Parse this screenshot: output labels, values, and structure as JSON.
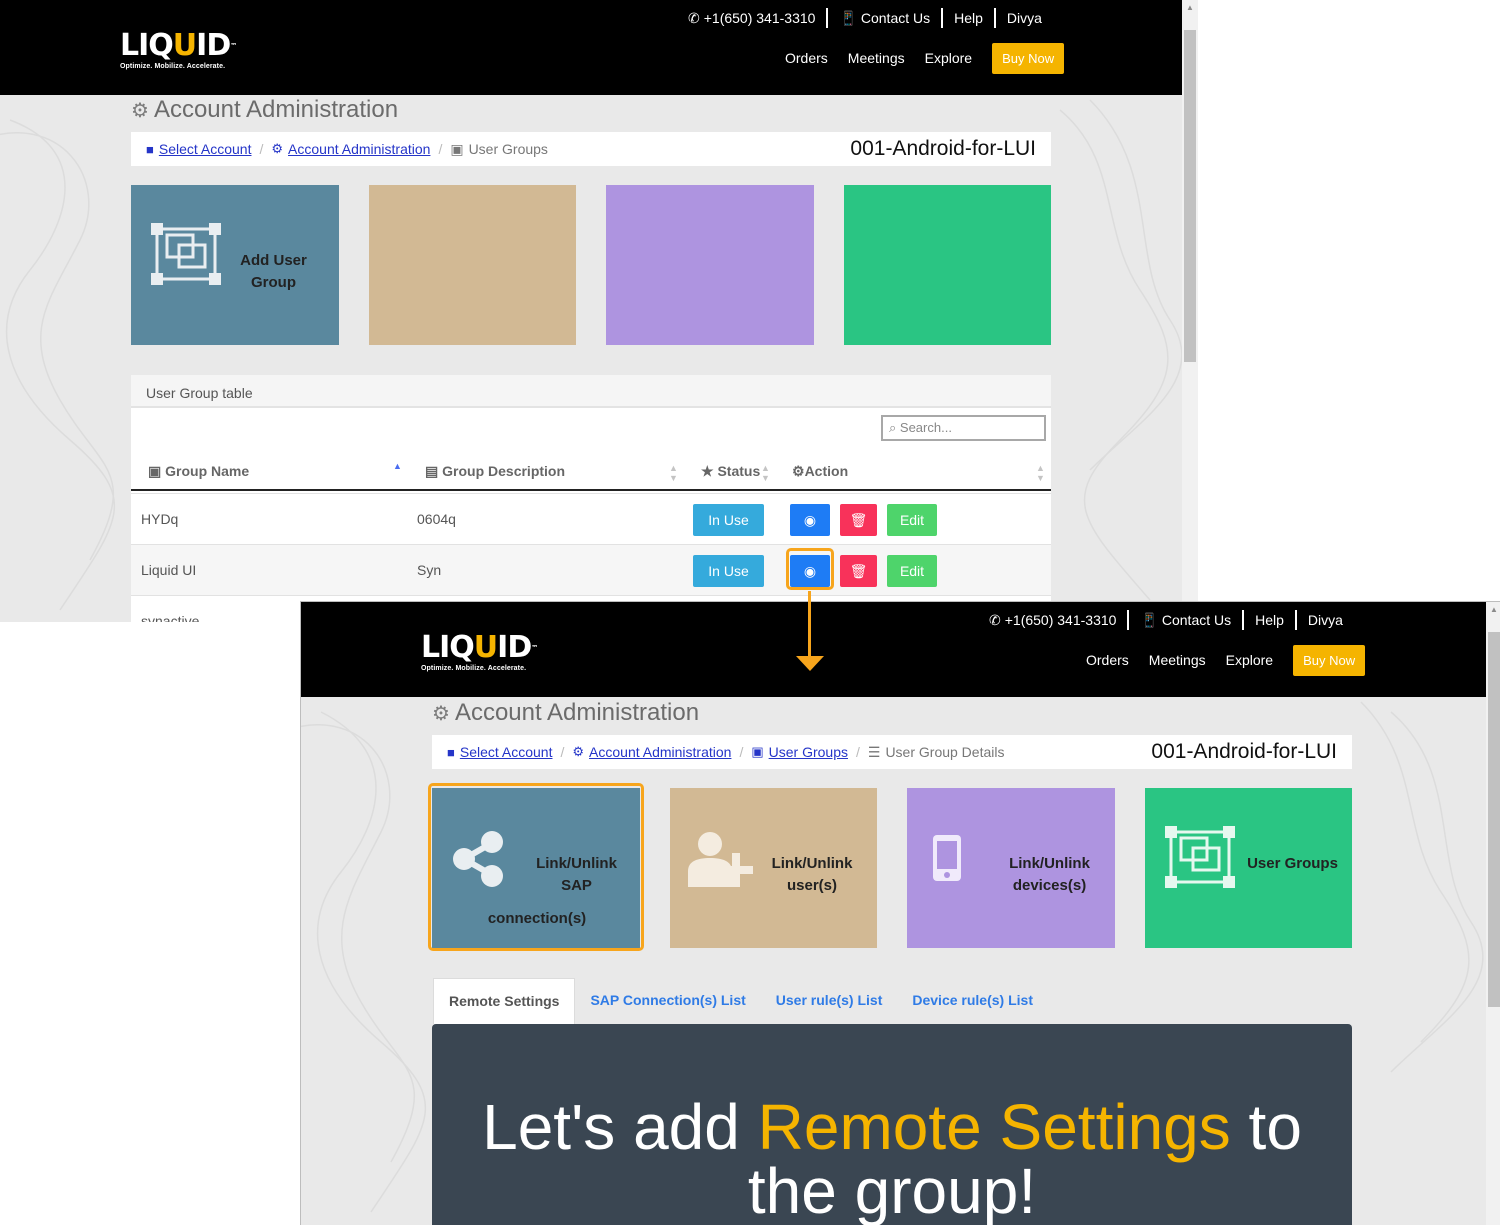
{
  "header": {
    "logo_main": "LIQ",
    "logo_accent": "U",
    "logo_end": "ID",
    "logo_tm": "™",
    "logo_tagline": "Optimize. Mobilize. Accelerate.",
    "phone": "+1(650) 341-3310",
    "contact": "Contact Us",
    "help": "Help",
    "user": "Divya",
    "nav": [
      "Orders",
      "Meetings",
      "Explore"
    ],
    "buy_now": "Buy Now"
  },
  "page_title": "Account Administration",
  "account_name": "001-Android-for-LUI",
  "screen1": {
    "breadcrumb": [
      "Select Account",
      "Account Administration",
      "User Groups"
    ],
    "tiles": [
      {
        "label_line1": "Add User",
        "label_line2": "Group",
        "color": "#5a889e",
        "icon": "user-group-icon"
      },
      {
        "label_line1": "",
        "label_line2": "",
        "color": "#d2b994"
      },
      {
        "label_line1": "",
        "label_line2": "",
        "color": "#ae94e0"
      },
      {
        "label_line1": "",
        "label_line2": "",
        "color": "#2ac583"
      }
    ],
    "table": {
      "title": "User Group table",
      "search_placeholder": "Search...",
      "headers": [
        "Group Name",
        "Group Description",
        "Status",
        "Action"
      ],
      "rows": [
        {
          "name": "HYDq",
          "description": "0604q",
          "status": "In Use",
          "edit": "Edit"
        },
        {
          "name": "Liquid UI",
          "description": "Syn",
          "status": "In Use",
          "edit": "Edit"
        },
        {
          "name": "synactive",
          "description": "",
          "status": "",
          "edit": ""
        }
      ]
    }
  },
  "screen2": {
    "breadcrumb": [
      "Select Account",
      "Account Administration",
      "User Groups",
      "User Group Details"
    ],
    "tiles": [
      {
        "lines": [
          "Link/Unlink",
          "SAP",
          "connection(s)"
        ],
        "color": "#5a889e",
        "icon": "share-icon"
      },
      {
        "lines": [
          "Link/Unlink",
          "user(s)"
        ],
        "color": "#d2b994",
        "icon": "add-user-icon"
      },
      {
        "lines": [
          "Link/Unlink",
          "devices(s)"
        ],
        "color": "#ae94e0",
        "icon": "mobile-device-icon"
      },
      {
        "lines": [
          "User Groups"
        ],
        "color": "#2ac583",
        "icon": "user-group-icon"
      }
    ],
    "tabs": [
      "Remote Settings",
      "SAP Connection(s) List",
      "User rule(s) List",
      "Device rule(s) List"
    ],
    "hero": {
      "pre": "Let's add ",
      "highlight": "Remote Settings",
      "post": " to",
      "line2": "the group!"
    }
  },
  "colors": {
    "accent": "#f5b400",
    "callout": "#f7a51c",
    "link": "#2535c8",
    "hero_bg": "#3a4652"
  }
}
